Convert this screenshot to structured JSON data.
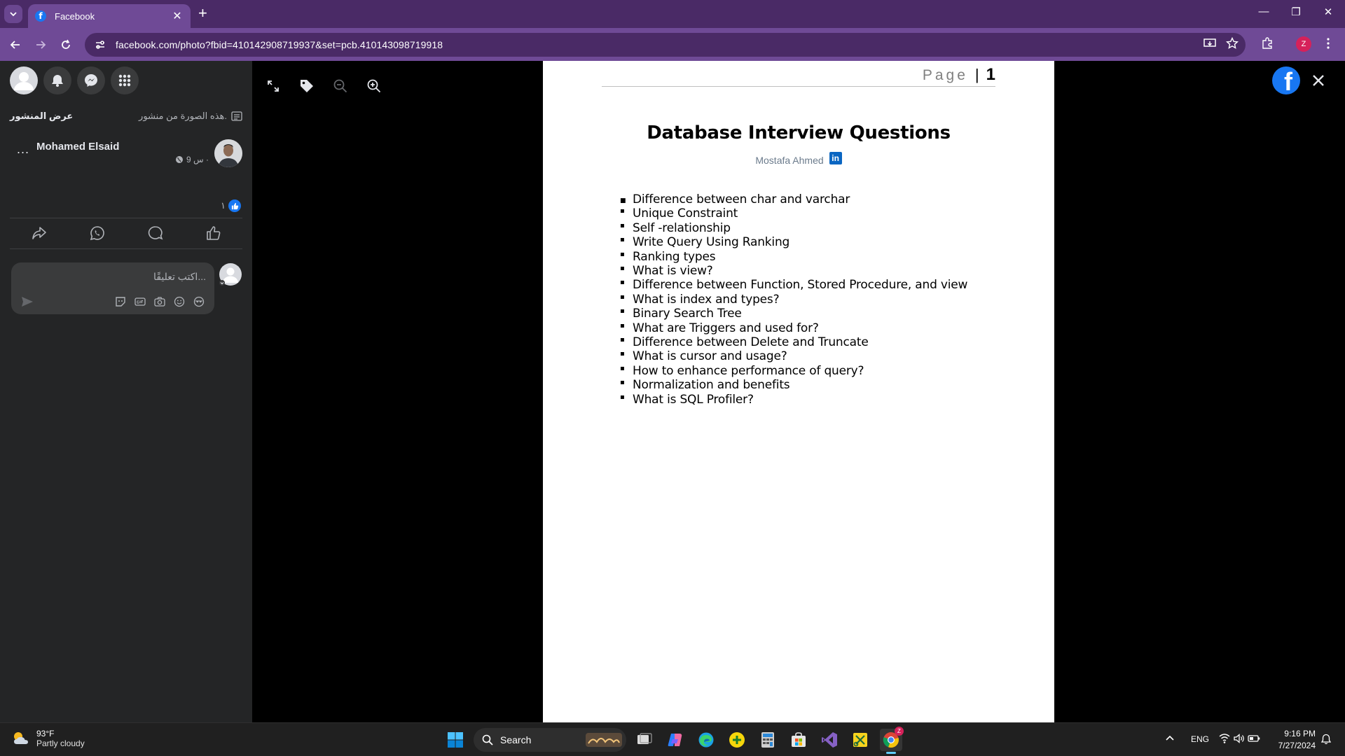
{
  "browser": {
    "tab_title": "Facebook",
    "tab_favicon": "f",
    "url": "facebook.com/photo?fbid=410142908719937&set=pcb.410143098719918",
    "profile_initial": "Z",
    "accent": "#6f4a96"
  },
  "sidebar": {
    "view_post": "عرض المنشور",
    "photo_note": "هذه الصورة من منشور.",
    "author_name": "Mohamed Elsaid",
    "more": "...",
    "post_time": "9 س ·",
    "reaction_count": "١",
    "comment_placeholder": "اكتب تعليقًا..."
  },
  "document": {
    "page_word": "Page",
    "page_sep": "|",
    "page_number": "1",
    "title": "Database Interview Questions",
    "author": "Mostafa Ahmed",
    "linkedin_badge": "in",
    "bullet_first": "■",
    "bullet": "▪",
    "questions": [
      "Difference between char and varchar",
      "Unique Constraint",
      "Self -relationship",
      "Write Query Using Ranking",
      "Ranking types",
      "What is view?",
      "Difference between Function, Stored Procedure, and view",
      "What is index and types?",
      "Binary Search Tree",
      "What are Triggers and used for?",
      "Difference between Delete and Truncate",
      "What is cursor and usage?",
      "How to enhance performance of query?",
      "Normalization and benefits",
      "What is SQL Profiler?"
    ]
  },
  "taskbar": {
    "temperature": "93°F",
    "condition": "Partly cloudy",
    "search_label": "Search",
    "lang": "ENG",
    "time": "9:16 PM",
    "date": "7/27/2024",
    "chrome_badge": "Z"
  }
}
